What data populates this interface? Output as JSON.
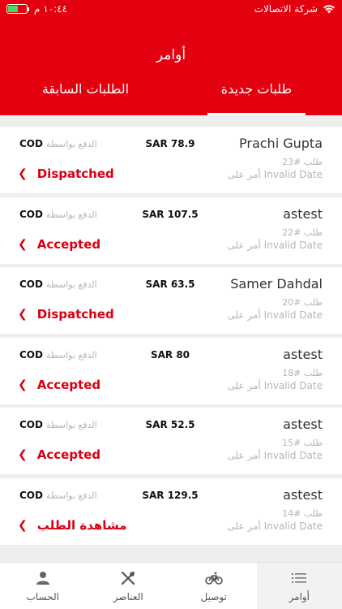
{
  "status_bar": {
    "carrier": "شركة الاتصالات",
    "time": "١٠:٤٤ م",
    "battery_level": 0.55,
    "battery_color": "#4cd964"
  },
  "header": {
    "title": "أوامر",
    "background": "#e3000f"
  },
  "tabs": {
    "active": "طلبات جديدة",
    "inactive": "الطلبات السابقة"
  },
  "pay_text": "الدفع بواسطة",
  "order_prefix": "طلب",
  "date_prefix": "أمر على",
  "orders": [
    {
      "customer": "Prachi Gupta",
      "order": "#23",
      "date": "Invalid Date",
      "amount": "SAR 78.9",
      "method": "COD",
      "status": "Dispatched"
    },
    {
      "customer": "astest",
      "order": "#22",
      "date": "Invalid Date",
      "amount": "SAR 107.5",
      "method": "COD",
      "status": "Accepted"
    },
    {
      "customer": "Samer Dahdal",
      "order": "#20",
      "date": "Invalid Date",
      "amount": "SAR 63.5",
      "method": "COD",
      "status": "Dispatched"
    },
    {
      "customer": "astest",
      "order": "#18",
      "date": "Invalid Date",
      "amount": "SAR 80",
      "method": "COD",
      "status": "Accepted"
    },
    {
      "customer": "astest",
      "order": "#15",
      "date": "Invalid Date",
      "amount": "SAR 52.5",
      "method": "COD",
      "status": "Accepted"
    },
    {
      "customer": "astest",
      "order": "#14",
      "date": "Invalid Date",
      "amount": "SAR 129.5",
      "method": "COD",
      "status": "مشاهدة الطلب"
    }
  ],
  "nav": [
    {
      "label": "الحساب",
      "icon": "user-icon"
    },
    {
      "label": "العناصر",
      "icon": "cutlery-icon"
    },
    {
      "label": "توصيل",
      "icon": "bicycle-icon"
    },
    {
      "label": "أوامر",
      "icon": "list-icon",
      "active": true
    }
  ],
  "accent_color": "#d90012"
}
